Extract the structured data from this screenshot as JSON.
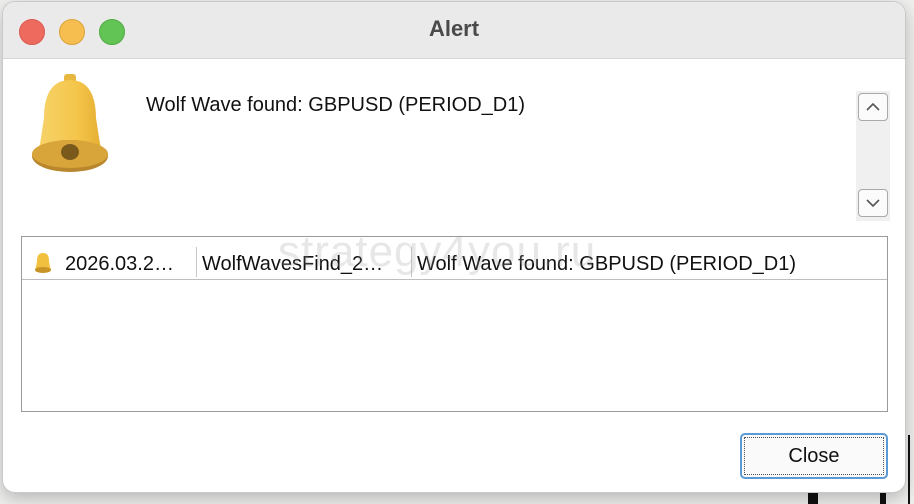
{
  "window": {
    "title": "Alert"
  },
  "alert": {
    "message": "Wolf Wave found: GBPUSD (PERIOD_D1)"
  },
  "watermark": "strategy4you.ru",
  "list": {
    "rows": [
      {
        "time": "2026.03.2…",
        "source": "WolfWavesFind_2…",
        "message": "Wolf Wave found: GBPUSD (PERIOD_D1)"
      }
    ]
  },
  "buttons": {
    "close_label": "Close"
  },
  "colors": {
    "bell": "#f4c54a",
    "accent": "#5b9bd5"
  }
}
